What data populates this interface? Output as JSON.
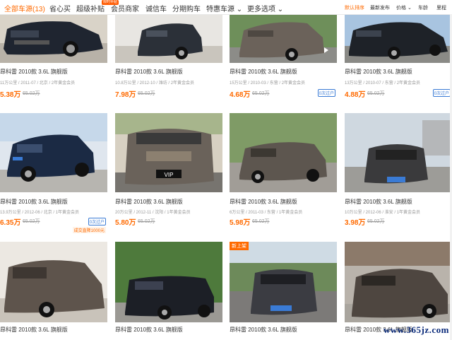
{
  "nav": {
    "items": [
      "全部车源(13)",
      "省心买",
      "超级补贴",
      "会员商家",
      "诚信车",
      "分期购车",
      "特惠车源 ⌄",
      "更多选项 ⌄"
    ],
    "badge": "限时补贴",
    "sort": [
      "默认排序",
      "最新发布",
      "价格 ⌄",
      "车龄",
      "里程"
    ]
  },
  "cars": [
    {
      "title": "昂科雷 2010款 3.6L 旗舰版",
      "meta": "11万公里 / 2011-07 / 北京 / 2年黄金会员",
      "price": "5.38万",
      "old": "65.02万",
      "tag": "",
      "tag2": ""
    },
    {
      "title": "昂科雷 2010款 3.6L 旗舰版",
      "meta": "10.8万公里 / 2012-10 / 潍坊 / 2年黄金会员",
      "price": "7.98万",
      "old": "65.02万",
      "tag": "",
      "tag2": ""
    },
    {
      "title": "昂科雷 2010款 3.6L 旗舰版",
      "meta": "15万公里 / 2010-03 / 东营 / 2年黄金会员",
      "price": "4.68万",
      "old": "65.02万",
      "tag": "0次过户",
      "tag2": ""
    },
    {
      "title": "昂科雷 2010款 3.6L 旗舰版",
      "meta": "13万公里 / 2010-07 / 东营 / 2年黄金会员",
      "price": "4.88万",
      "old": "65.02万",
      "tag": "0次过户",
      "tag2": ""
    },
    {
      "title": "昂科雷 2010款 3.6L 旗舰版",
      "meta": "13.9万公里 / 2012-06 / 北京 / 1年黄金会员",
      "price": "6.35万",
      "old": "65.02万",
      "tag": "0次过户",
      "tag2": "成交直降1000元"
    },
    {
      "title": "昂科雷 2010款 3.6L 旗舰版",
      "meta": "20万公里 / 2012-11 / 沈阳 / 1年黄金会员",
      "price": "5.80万",
      "old": "65.02万",
      "tag": "",
      "tag2": ""
    },
    {
      "title": "昂科雷 2010款 3.6L 旗舰版",
      "meta": "6万公里 / 2011-03 / 东营 / 1年黄金会员",
      "price": "5.98万",
      "old": "65.02万",
      "tag": "",
      "tag2": ""
    },
    {
      "title": "昂科雷 2010款 3.6L 旗舰版",
      "meta": "10万公里 / 2012-06 / 淮安 / 1年黄金会员",
      "price": "3.98万",
      "old": "65.02万",
      "tag": "",
      "tag2": ""
    },
    {
      "title": "昂科雷 2010款 3.6L 旗舰版",
      "meta": "",
      "price": "",
      "old": "",
      "tag": "",
      "tag2": ""
    },
    {
      "title": "昂科雷 2010款 3.6L 旗舰版",
      "meta": "",
      "price": "",
      "old": "",
      "tag": "",
      "tag2": ""
    },
    {
      "title": "昂科雷 2010款 3.6L 旗舰版",
      "meta": "",
      "price": "",
      "old": "",
      "tag": "",
      "tag2": ""
    },
    {
      "title": "昂科雷 2010款 3.6L 旗舰版",
      "meta": "",
      "price": "",
      "old": "",
      "tag": "",
      "tag2": ""
    }
  ],
  "new_label": "新上架",
  "plates": {
    "vip": "VIP"
  },
  "watermark": "www.365jz.com",
  "icons": [
    "play-icon",
    "chevron-down-icon"
  ],
  "colors": {
    "accent": "#ff6a00",
    "tag_blue": "#3a7bd5"
  }
}
